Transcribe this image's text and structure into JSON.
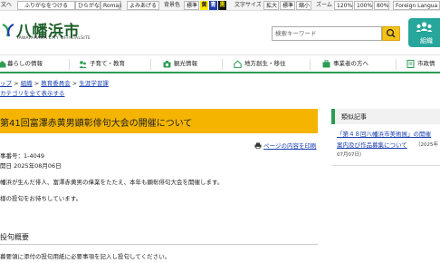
{
  "topbar": {
    "lang_cut": "文へ",
    "furigana_show": "ふりがなをつける",
    "hiragana": "ひらがな",
    "romaji": "Romaji",
    "read_aloud": "よみあげる",
    "bg_color_label": "背景色",
    "bg_standard": "標準",
    "bg_yellow": "黄",
    "bg_blue": "青",
    "bg_black": "黒",
    "text_size_label": "文字サイズ",
    "size_large": "拡大",
    "size_standard": "標準",
    "size_small": "縮小",
    "zoom_label": "ズーム",
    "zoom_120": "120%",
    "zoom_100": "100%",
    "zoom_80": "80%",
    "foreign_language": "Foreign Langua"
  },
  "header": {
    "site_title": "八幡浜市",
    "site_sub": "YAWATAHAMA CITY OFFICIALSITE",
    "search_placeholder": "検索キーワード",
    "org_label": "組織"
  },
  "nav": [
    {
      "label": "暮らしの情報",
      "icon": "house-icon"
    },
    {
      "label": "子育て・教育",
      "icon": "family-icon"
    },
    {
      "label": "観光情報",
      "icon": "camera-icon"
    },
    {
      "label": "地方創生・移住",
      "icon": "house-outline-icon"
    },
    {
      "label": "事業者の方へ",
      "icon": "briefcase-icon"
    },
    {
      "label": "市政情",
      "icon": "document-icon"
    }
  ],
  "breadcrumb": [
    "ップ",
    "組織",
    "教育委員会",
    "生涯学習課"
  ],
  "all_categories": "カテゴリを全て表示する",
  "article": {
    "title": "第41回富澤赤黄男顕彰俳句大会の開催について",
    "print": "ページの内容を印刷",
    "id_line": "事番号：1-4049",
    "date_line": "開日 2025年08月06日",
    "para1": "幡浜が生んだ俳人、富澤赤黄男の偉業をたたえ、本年も顕彰俳句大会を開催します。",
    "para2": "様の投句をお待ちしています。",
    "section_heading": "投句概要",
    "para3": "募要領に添付の投句用紙に必要事項を記入し投句してください。"
  },
  "sidebar": {
    "heading": "類似記事",
    "link_line1": "「第４８回八幡浜市美術展」の開催",
    "link_line2": "案内及び作品募集について",
    "note_line2": "（2025年",
    "note_line3": "07月07日）"
  },
  "colors": {
    "accent_green": "#2a9c53",
    "title_band": "#f5b400",
    "org_button": "#27a69c",
    "link": "#1a3fb0"
  }
}
